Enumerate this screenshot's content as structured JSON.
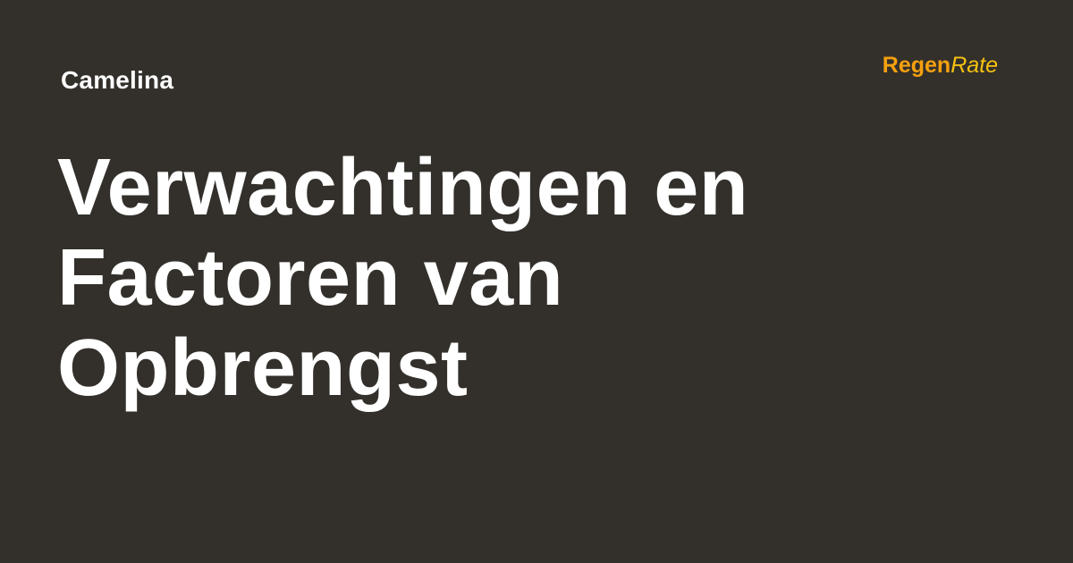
{
  "card": {
    "category": "Camelina",
    "brand": {
      "part1": "Regen",
      "part2": "Rate"
    },
    "title_lines": [
      "Verwachtingen en",
      "Factoren van",
      "Opbrengst"
    ],
    "colors": {
      "background": "#33302b",
      "text": "#ffffff",
      "brand_primary": "#f5a00f",
      "brand_secondary": "#f5c211"
    }
  }
}
